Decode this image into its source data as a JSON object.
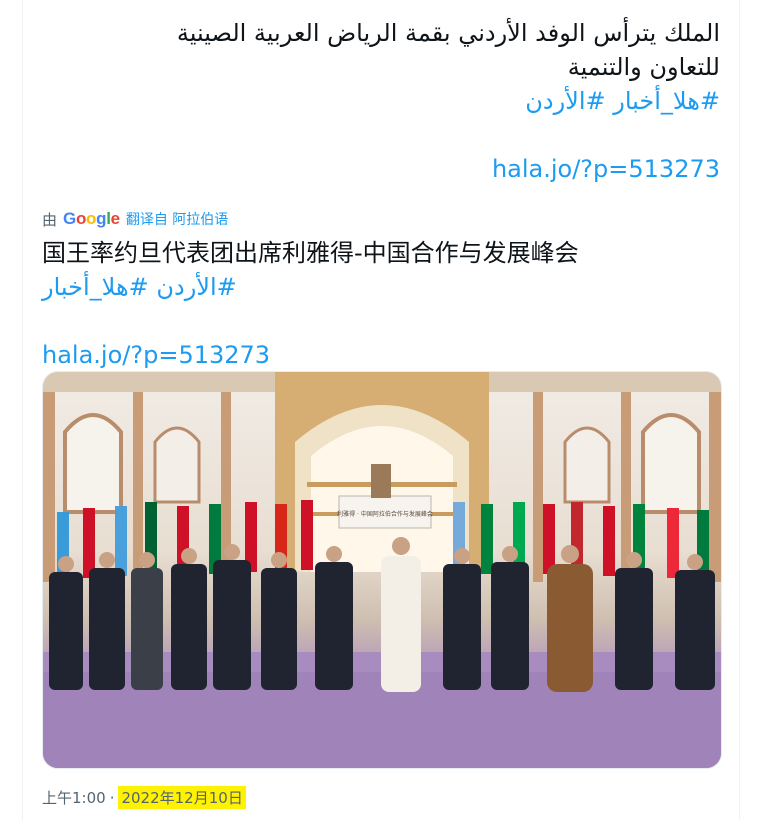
{
  "tweet": {
    "arabic_text": "الملك يترأس الوفد الأردني بقمة الرياض العربية الصينية\nللتعاون والتنمية",
    "arabic_hashtags": [
      "#هلا_أخبار",
      "#الأردن"
    ],
    "link": "hala.jo/?p=513273"
  },
  "translation": {
    "by_label": "由",
    "google_letters": [
      {
        "ch": "G",
        "color": "#4285f4"
      },
      {
        "ch": "o",
        "color": "#ea4335"
      },
      {
        "ch": "o",
        "color": "#fbbc05"
      },
      {
        "ch": "g",
        "color": "#4285f4"
      },
      {
        "ch": "l",
        "color": "#34a853"
      },
      {
        "ch": "e",
        "color": "#ea4335"
      }
    ],
    "translated_from_label": "翻译自 阿拉伯语",
    "translated_text": "国王率约旦代表团出席利雅得-中国合作与发展峰会",
    "translated_hashtags": [
      "#الأردن",
      "#هلا_أخبار"
    ],
    "link": "hala.jo/?p=513273"
  },
  "media": {
    "banner_text": "利雅得 · 中国阿拉伯合作与发展峰会"
  },
  "meta": {
    "time": "上午1:00",
    "separator": "·",
    "date": "2022年12月10日"
  },
  "colors": {
    "link_blue": "#1d9bf0",
    "text_primary": "#0f1419",
    "text_secondary": "#536471",
    "date_highlight": "#fff200"
  }
}
